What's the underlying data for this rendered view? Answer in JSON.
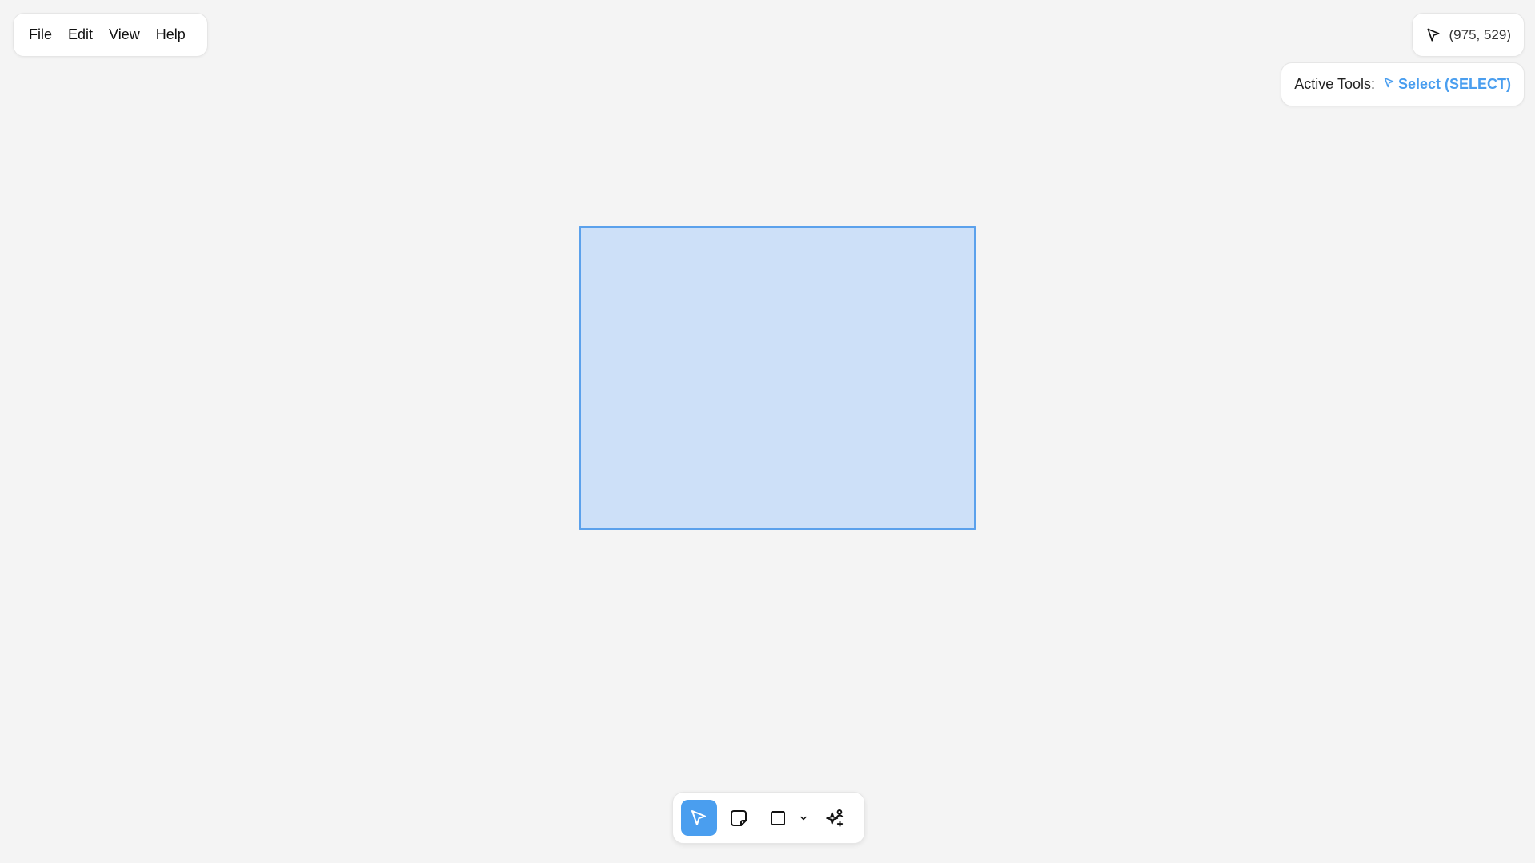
{
  "menu": {
    "items": [
      {
        "label": "File"
      },
      {
        "label": "Edit"
      },
      {
        "label": "View"
      },
      {
        "label": "Help"
      }
    ]
  },
  "cursor": {
    "icon": "pointer-arrow-icon",
    "position_text": "(975, 529)"
  },
  "active_tools": {
    "label": "Active Tools:",
    "tool_icon": "pointer-arrow-icon",
    "tool_name": "Select (SELECT)",
    "accent_color": "#4a9eef"
  },
  "canvas": {
    "background_color": "#f4f4f4",
    "shape": {
      "type": "rectangle",
      "fill_color": "#cde0f8",
      "stroke_color": "#5ba1ec"
    }
  },
  "toolbar": {
    "tools": [
      {
        "name": "select",
        "icon": "pointer-arrow-icon",
        "active": true
      },
      {
        "name": "sticky-note",
        "icon": "sticky-note-icon",
        "active": false
      },
      {
        "name": "rectangle",
        "icon": "square-icon",
        "active": false
      },
      {
        "name": "shape-options",
        "icon": "chevron-down-icon",
        "active": false
      },
      {
        "name": "ai",
        "icon": "sparkles-person-icon",
        "active": false
      }
    ]
  }
}
